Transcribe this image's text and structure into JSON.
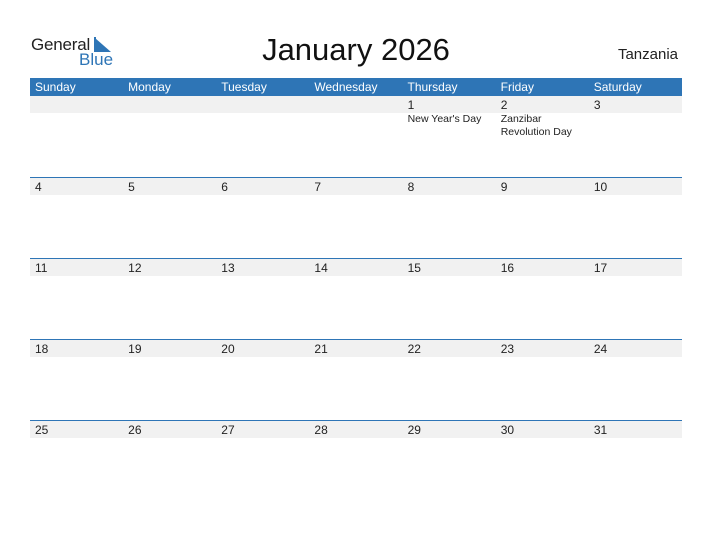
{
  "logo": {
    "word1": "General",
    "word2": "Blue",
    "icon": "triangle-flag-icon",
    "accent": "#2e75b6"
  },
  "title": "January 2026",
  "country": "Tanzania",
  "colors": {
    "header_bg": "#2e75b6",
    "band_bg": "#f1f1f1"
  },
  "weekdays": [
    "Sunday",
    "Monday",
    "Tuesday",
    "Wednesday",
    "Thursday",
    "Friday",
    "Saturday"
  ],
  "weeks": [
    [
      {
        "day": ""
      },
      {
        "day": ""
      },
      {
        "day": ""
      },
      {
        "day": ""
      },
      {
        "day": "1",
        "event": "New Year's Day"
      },
      {
        "day": "2",
        "event": "Zanzibar Revolution Day"
      },
      {
        "day": "3"
      }
    ],
    [
      {
        "day": "4"
      },
      {
        "day": "5"
      },
      {
        "day": "6"
      },
      {
        "day": "7"
      },
      {
        "day": "8"
      },
      {
        "day": "9"
      },
      {
        "day": "10"
      }
    ],
    [
      {
        "day": "11"
      },
      {
        "day": "12"
      },
      {
        "day": "13"
      },
      {
        "day": "14"
      },
      {
        "day": "15"
      },
      {
        "day": "16"
      },
      {
        "day": "17"
      }
    ],
    [
      {
        "day": "18"
      },
      {
        "day": "19"
      },
      {
        "day": "20"
      },
      {
        "day": "21"
      },
      {
        "day": "22"
      },
      {
        "day": "23"
      },
      {
        "day": "24"
      }
    ],
    [
      {
        "day": "25"
      },
      {
        "day": "26"
      },
      {
        "day": "27"
      },
      {
        "day": "28"
      },
      {
        "day": "29"
      },
      {
        "day": "30"
      },
      {
        "day": "31"
      }
    ]
  ]
}
